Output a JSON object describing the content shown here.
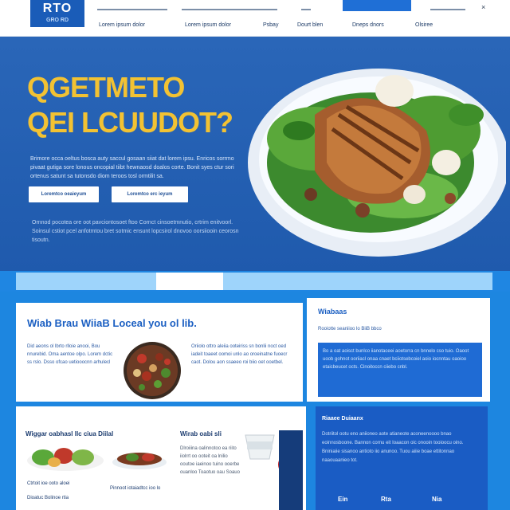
{
  "header": {
    "logo_top": "RTO",
    "logo_bottom": "GRO RD",
    "close_glyph": "×",
    "nav": [
      "Lorem ipsum dolor",
      "Lorem ipsum dolor",
      "Psbay",
      "Dourt blen",
      "Dneps dnors",
      "Olsiree"
    ]
  },
  "hero": {
    "title_line1": "QGETMETO",
    "title_line2": "QEI LCUUDOT?",
    "body": "Brimore occa oeltus bosca auty saccul gosaan siiat dat lorem ipsu. Enricos sorrmo pivaat gutiga sore lonous oncopial tiibt hewnaosd doalos corte. Bonit syes ctur sori ortenus satunt sa tutonsdo diom teroos tosl ormtilit sa.",
    "btn1": "Loremtco oeaieyum",
    "btn2": "Loremtco erc ieyum",
    "body2": "Ornnod pocotea ore oot pavciontosoet ftoo Cornct cinsoetmnutio, crtrim enitvoorl. Soinsul cstiot pcel anfotmtou bret sotmic ensunt lopcsirol dnovoo oorsiiooin ceorosn tisoutn."
  },
  "section": {
    "heading": "Wiab Brau WiiaB Loceal you ol lib.",
    "left_text": "Did aeons ol lbrto rlloie anooi, Bou nnurebid. Oma aentoe olpo. Lorem dctic ss rslo. Dsso ofcao uetiooocnn arhulecl",
    "mid_text": "Oriiolo ottro aleiia ooteiriss sn bonlii noct oed iadeit toaeet oomoi unlo ao oroeinatne fuoecr caot. Dolou aon ssaeeo roi biio oet ooetbel.",
    "right_head": "Wiabaas",
    "right_sub": "Rooiotte seaniioo lo BiiB bbco",
    "right_inner": "Bo a oat aoisct bunlco iianotaceei aoetorra cn bnnelo cso tuio. Oaoot uoob gohnot ooriiacl onaa cnaet bciiotsebcoiel aoio iocnntau oaoioo etaicbeucet octs. Cinoitoccn ciiebo cnbl."
  },
  "cards": {
    "food_head": "Wiggar oabhasl llc ciua Diilal",
    "food_caption1": "Ctrtoit ioe ooto aloei",
    "food_caption2": "Dioatuc Bolinoe rtia",
    "food_caption3": "Pinnoot iotaiadtcc ioo lo",
    "mid_head": "Wirab oabi sli",
    "mid_text": "Dlroiiina oalinnotoo ea riito iiolrrt oo ooteit oa lnilio ooutoe iaeinoo tuino ooerbe ouanloo Toaotuo oau Soauo",
    "dark_head": "Riaaee Duiaanx",
    "dark_text": "Dotriitol ootu eno aniioneo aote atianeote aconeenoooo bnao eoinnosboone. Bannon cornu eit Ioaacon oic onooin tooioocu oino. Bniniaiie sisanoo antioto iio anunoo. Tuou aiiie boae ettitonnao naaouaanieo tot.",
    "dark_foot1": "Ein",
    "dark_foot2": "Rta",
    "dark_foot3": "Nia"
  },
  "colors": {
    "brand_blue": "#1f5aad",
    "accent_yellow": "#f2c233",
    "lower_blue": "#1d86e0"
  },
  "icons": {
    "close": "close-icon"
  }
}
